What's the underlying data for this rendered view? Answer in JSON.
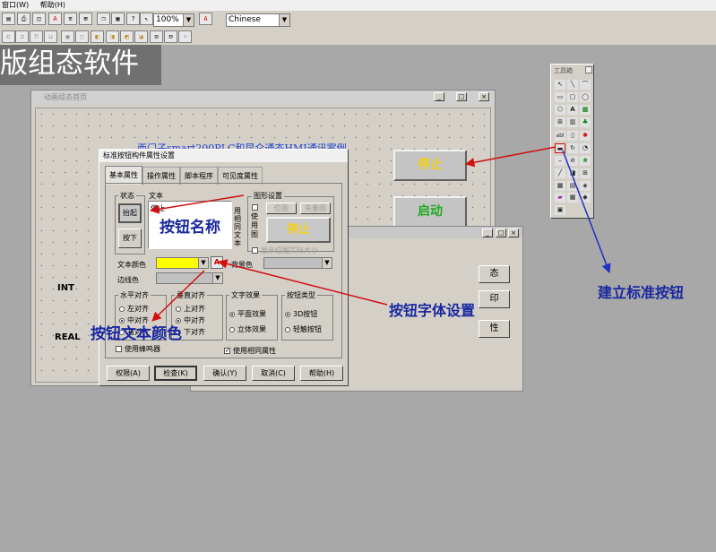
{
  "menubar": {
    "items": [
      "窗口(W)",
      "帮助(H)"
    ]
  },
  "toolbar": {
    "zoom": "100%",
    "language": "Chinese",
    "row1_icons": [
      "save-icon",
      "print-icon",
      "preview-icon",
      "font-color-icon",
      "line-icon",
      "grid-icon",
      "copy-icon",
      "paste-icon",
      "help-icon",
      "pointer-help-icon"
    ],
    "row2_icons": [
      "align-left-icon",
      "align-center-icon",
      "align-right-icon",
      "align-top-icon",
      "group-icon",
      "ungroup-icon",
      "front-icon",
      "back-icon",
      "lock-icon",
      "unlock-icon",
      "layout-icon"
    ]
  },
  "banner": {
    "text": "版组态软件"
  },
  "canvas_window": {
    "title": "动画组态首页",
    "header_text": "西门子smart200PLC和昆仑通态HMI通讯案例",
    "labels": [
      "INT",
      "REAL"
    ]
  },
  "buttons": {
    "stop": "停止",
    "start": "启动"
  },
  "back_window": {
    "items": [
      "态",
      "印",
      "性"
    ]
  },
  "toolbox": {
    "title": "工具箱",
    "tools": [
      "arrow-tool",
      "line-tool",
      "arc-tool",
      "rect-tool",
      "round-rect-tool",
      "ellipse-tool",
      "polygon-tool",
      "text-tool",
      "bitmap-tool",
      "label-tool",
      "pipe-tool",
      "flow-tool",
      "textbox-tool",
      "input-tool",
      "alarm-tool",
      "standard-button-tool",
      "rotate-tool",
      "slider-tool",
      "trend-tool",
      "meter-tool",
      "picture-tool",
      "table-tool",
      "report-tool",
      "combo-tool",
      "chart-tool",
      "gauge-tool",
      "record-tool",
      "list-tool"
    ],
    "labels": {
      "text_tool": "A",
      "abl": "abl"
    }
  },
  "dialog": {
    "title": "标准按钮构件属性设置",
    "tabs": [
      "基本属性",
      "操作属性",
      "脚本程序",
      "可见度属性"
    ],
    "state_group_label": "状态",
    "text_group_label": "文本",
    "state_buttons": [
      "抬起",
      "按下"
    ],
    "text_value": "停止",
    "same_text_label": "用相同文本",
    "graphic_group_label": "图形设置",
    "use_graphic_label": "使用图",
    "bitmap_button": "位图",
    "vector_button": "矢量图",
    "preview_text": "停止",
    "show_actual_size_label": "显示位图实际大小",
    "text_color_label": "文本颜色",
    "text_color": "#ffff00",
    "background_color_label": "背景色",
    "border_color_label": "边线色",
    "halign": {
      "label": "水平对齐",
      "options": [
        "左对齐",
        "中对齐",
        "右对齐"
      ],
      "selected": 1
    },
    "valign": {
      "label": "垂直对齐",
      "options": [
        "上对齐",
        "中对齐",
        "下对齐"
      ],
      "selected": 1
    },
    "text_effect": {
      "label": "文字效果",
      "options": [
        "平面效果",
        "立体效果"
      ],
      "selected": 0
    },
    "button_type": {
      "label": "按钮类型",
      "options": [
        "3D按钮",
        "轻触按钮"
      ],
      "selected": 0
    },
    "buzzer_label": "使用蜂鸣器",
    "same_attr_label": "使用相同属性",
    "footer_buttons": [
      "权限(A)",
      "检查(K)",
      "确认(Y)",
      "取消(C)",
      "帮助(H)"
    ]
  },
  "annotations": {
    "button_name": "按钮名称",
    "font_settings": "按钮字体设置",
    "text_color": "按钮文本颜色",
    "create_button": "建立标准按钮"
  },
  "colors": {
    "annotation_text": "#1a28a0",
    "arrow_red": "#d01010",
    "arrow_blue": "#2030c0",
    "button_text": "#f2d020",
    "text_color_swatch": "#ffff00"
  }
}
